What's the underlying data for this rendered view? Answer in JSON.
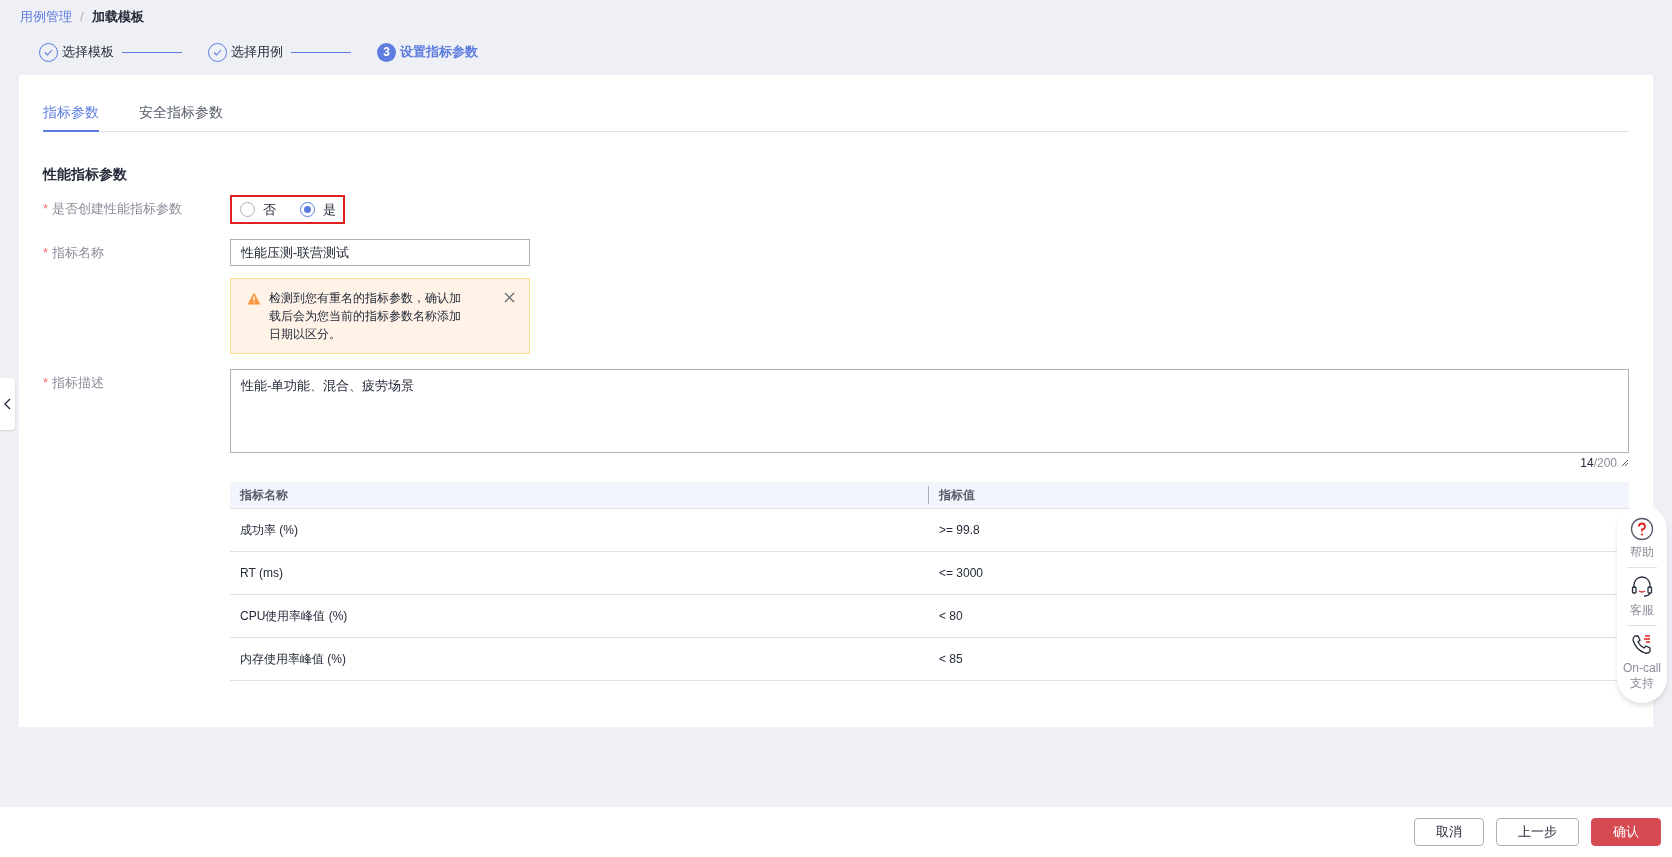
{
  "breadcrumb": [
    {
      "label": "用例管理",
      "current": false
    },
    {
      "label": "加载模板",
      "current": true
    }
  ],
  "breadcrumb_separator": "/",
  "steps": [
    {
      "label": "选择模板",
      "completed": true,
      "active": false
    },
    {
      "label": "选择用例",
      "completed": true,
      "active": false
    },
    {
      "label": "设置指标参数",
      "completed": false,
      "active": true,
      "number": "3"
    }
  ],
  "tabs": [
    {
      "label": "指标参数",
      "selected": true
    },
    {
      "label": "安全指标参数",
      "selected": false
    }
  ],
  "section_title": "性能指标参数",
  "create_field": {
    "label": "是否创建性能指标参数",
    "required_mark": "*",
    "options": [
      {
        "label": "否",
        "selected": false
      },
      {
        "label": "是",
        "selected": true
      }
    ]
  },
  "name_field": {
    "label": "指标名称",
    "required_mark": "*",
    "value": "性能压测-联营测试"
  },
  "warning": {
    "text": "检测到您有重名的指标参数，确认加载后会为您当前的指标参数名称添加日期以区分。"
  },
  "description_field": {
    "label": "指标描述",
    "required_mark": "*",
    "value": "性能-单功能、混合、疲劳场景",
    "count": "14",
    "max": "/200"
  },
  "table": {
    "columns": [
      "指标名称",
      "指标值"
    ],
    "rows": [
      [
        "成功率 (%)",
        ">= 99.8"
      ],
      [
        "RT (ms)",
        "<= 3000"
      ],
      [
        "CPU使用率峰值 (%)",
        "< 80"
      ],
      [
        "内存使用率峰值 (%)",
        "< 85"
      ]
    ]
  },
  "float_panel": [
    {
      "kind": "help",
      "label": "帮助"
    },
    {
      "kind": "service",
      "label": "客服"
    },
    {
      "kind": "oncall",
      "label": "On-call 支持"
    }
  ],
  "footer_buttons": [
    {
      "kind": "default",
      "label": "取消"
    },
    {
      "kind": "default",
      "label": "上一步"
    },
    {
      "kind": "primary",
      "label": "确认"
    }
  ]
}
